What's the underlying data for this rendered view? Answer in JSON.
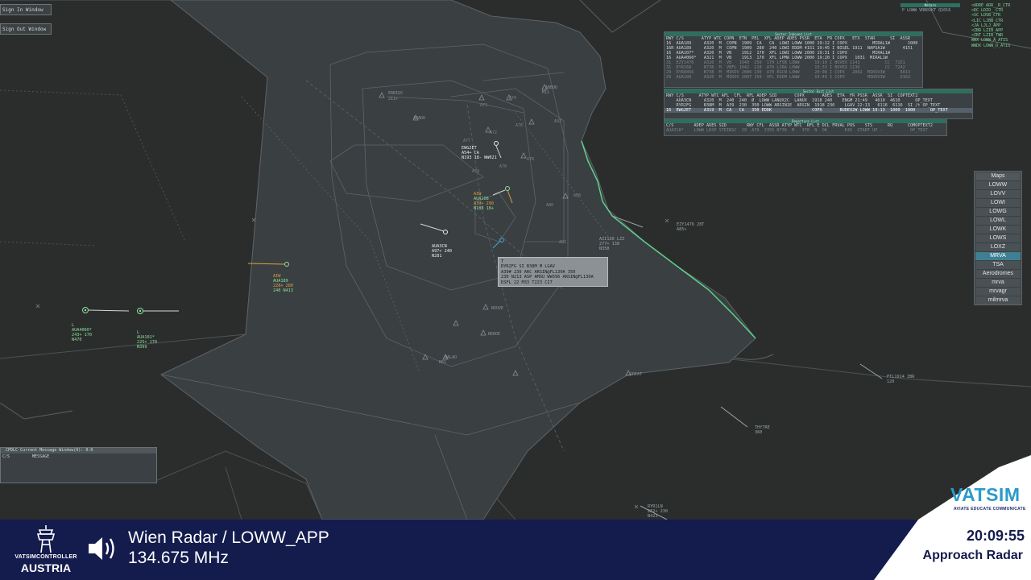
{
  "windows": {
    "top1": "Sign In Window",
    "top2": "Sign Out Window"
  },
  "metar": {
    "caption": "Metars",
    "text": "P LOWW VRB01KT Q1016"
  },
  "atis_lines": [
    "<ADRE ADR__R_CTR",
    "<DC LDZO__CTR",
    "<SC LOSB_CTR",
    "<LIC LJBB_CTR",
    "<JA LJLJ_APP",
    "<ZBR LZIB_APP",
    "<ZBT LZIB_TWR",
    "WWX LOWW_A_ATIS",
    "WWDX LOWW_D_ATIS"
  ],
  "arrival_list": {
    "caption": "Sector Inbound List",
    "header": "RWY C/S       ATYP WTC COPN  ETN  PEL  XFL ADEP ADES PSSR  ETA  FR COPX   ETX  STAR      SI  ASSR",
    "rows": [
      {
        "text": "16  AUA189     A320  M  COPN  1909  CA   CA  LOWI LOWW 1000 19:12 I COPX          MIRAL1W       1000",
        "style": "normal"
      },
      {
        "text": "16R AUA189     A320  M  COPN  1909  280  240 LOWI EDDM 4151 19:45 I NIGEL 1911  NAPSA1W       4151",
        "style": "normal"
      },
      {
        "text": "16  AUA107*    A320  M  VB    1912  170  XFL LOWI LOWW 2000 19:31 I COPX          MIRAL1W",
        "style": "normal"
      },
      {
        "text": "16  AUA4060*   A321  M  VB    1913  170  XFL LPMA LOWW 2000 19:20 I COPX   1031  MIRAL1W",
        "style": "normal"
      },
      {
        "text": "31  EZY1476    A320  M  VB   1940  250  170 LFSB LOWW      19:19 I BUVEX 1141          CC  7151",
        "style": "dim"
      },
      {
        "text": "31  RYR168     B738  M  VBFL 1942  210  A70 LIRA LOWW      19:33 I BUVEX 1130          CC  7242",
        "style": "dim"
      },
      {
        "text": "29  RYR6856    B738  M  MIKOV 2006 130  A70 EGCN LOWW      20:08 I COPX   2002  MIKOV3W      6013",
        "style": "dim"
      },
      {
        "text": "29  AUA189     A320  M  MIKOV 2007 150  XFL EDDM LOWW      19:49 I COPX         MIKOV3W      0163",
        "style": "dim"
      }
    ]
  },
  "sector_list": {
    "caption": "Sector Exit List",
    "header": "RWY C/S      ATYP WTC AFL  CFL  RFL ADEP SID       COPX       ADES  ETA  FR PSSR  ASSR  SI  COPTEXT2",
    "rows": [
      {
        "text": "    AUA3CN     A320  M  240  240  Ø  LOWW LANUX2C  LANUX  1918 240    ENGM 21:49   4610  4610      OP_TEXT",
        "style": "normal"
      },
      {
        "text": "    RYR2FG     B38M  M  A39  230  350 LOWW ARSIN1E  ARSIN  1918 230    LGAV 22:13   6116  6116  SI /t OP_TEXT",
        "style": "normal"
      },
      {
        "text": "16  EWG2ET     A319  M  CA   CA   350 EDDK                COPX       BUDEX2W LOWW 19:13  1000  1000      OP_TEXT",
        "style": "hl"
      }
    ]
  },
  "departure_list": {
    "caption": "Departure List",
    "header": "C/S        ADEP ADES SID        RWY CFL  ASSR ATYP WTC  RFL E DCL FRVAL POS    STS      RQ      COMOPTEXT2",
    "rows": [
      {
        "text": "AUA318*    LOWW LDSP STEIN1C  29  A70  2355 B738  M   370  N  OK       E45  START UP -           OP_TEXT",
        "style": "dim"
      }
    ]
  },
  "maps_panel": {
    "title": "Maps",
    "items": [
      "LOWW",
      "LOVV",
      "LOWI",
      "LOWG",
      "LOWL",
      "LOWK",
      "LOWS",
      "LOXZ",
      "MRVA",
      "TSA",
      "Aerodromes",
      "mrva",
      "mrvagr",
      "milmrva"
    ],
    "active": "MRVA"
  },
  "cpdlc": {
    "caption": "CPDLC Current Message Window(0): 0:0",
    "col1": "C/S",
    "col2": "MESSAGE"
  },
  "tooltip": {
    "lines": [
      "T",
      "RYR2FG SI B38M M LGAV",
      "A39# 230 ARC ARSIN@FL130A 350",
      "230 N213 ASP AMSU WW396 ARSIN@FL130A",
      "DSFL 22 M33 T223 C27"
    ]
  },
  "fixes": [
    {
      "name": "ERBIQS",
      "sub": "211+"
    },
    {
      "name": "ARADU"
    },
    {
      "name": "ABBOD"
    },
    {
      "name": "M11"
    },
    {
      "name": "NVOVE"
    },
    {
      "name": "NEBOE"
    },
    {
      "name": "WALAO"
    },
    {
      "name": "B61"
    },
    {
      "name": "GREAT"
    },
    {
      "name": "EVMBA"
    }
  ],
  "tracks": [
    {
      "id": "AUA4060",
      "lines": [
        "L",
        "AUA4060*",
        "243+ 170",
        "N470"
      ],
      "color": "#8de09b"
    },
    {
      "id": "AUA101",
      "lines": [
        "L",
        "AUA101*",
        "225+ 170",
        "N399"
      ],
      "color": "#8de09b"
    },
    {
      "id": "AUA189",
      "lines": [
        "AIW",
        "AUA189",
        "228+ 280",
        "240 N413"
      ],
      "color": "#e0a040"
    },
    {
      "id": "AUA108",
      "lines": [
        "AIW",
        "AUA108",
        "A39+ 290",
        "N188 18+"
      ],
      "color": "#e0a040"
    },
    {
      "id": "AUA3CN",
      "lines": [
        "",
        "AUA3CN",
        "A97+ 240",
        "N281"
      ],
      "color": "#e8ecee"
    },
    {
      "id": "EWG2ET",
      "lines": [
        "",
        "EWG2ET",
        "A54+ CA",
        "N193 18- WW021"
      ],
      "color": "#e8ecee"
    },
    {
      "id": "AZI130",
      "lines": [
        "",
        "AZI130 LZZ",
        "277+ 138",
        "N358"
      ],
      "color": "#9aa4a8"
    },
    {
      "id": "EZY1476",
      "lines": [
        "",
        "EZY1476 28T",
        "A85+",
        ""
      ],
      "color": "#9aa4a8"
    },
    {
      "id": "FTL1914",
      "lines": [
        "",
        "FTL1914 ZBR",
        "120",
        ""
      ],
      "color": "#9aa4a8"
    },
    {
      "id": "THY7RE",
      "lines": [
        "",
        "THY7RE",
        "360",
        ""
      ],
      "color": "#9aa4a8"
    },
    {
      "id": "RYR1LN",
      "lines": [
        "",
        "RYR1LN",
        "262+ 230",
        "N423"
      ],
      "color": "#9aa4a8"
    }
  ],
  "bottom_bar": {
    "org_line1": "VATSIMCONTROLLER",
    "org_line2": "AUSTRIA",
    "station": "Wien Radar / LOWW_APP",
    "frequency": "134.675 MHz",
    "time": "20:09:55",
    "mode": "Approach Radar",
    "vatsim": "VATSIM",
    "vatsim_tagline": "AVIATE  EDUCATE  COMMUNICATE"
  },
  "colors": {
    "background": "#2b2d2d",
    "sector_fill": "#3a3f42",
    "border_green": "#5fd08a",
    "bar_navy": "#141b4d",
    "vatsim_blue": "#2a9bc9",
    "active_map": "#3f7f93"
  }
}
